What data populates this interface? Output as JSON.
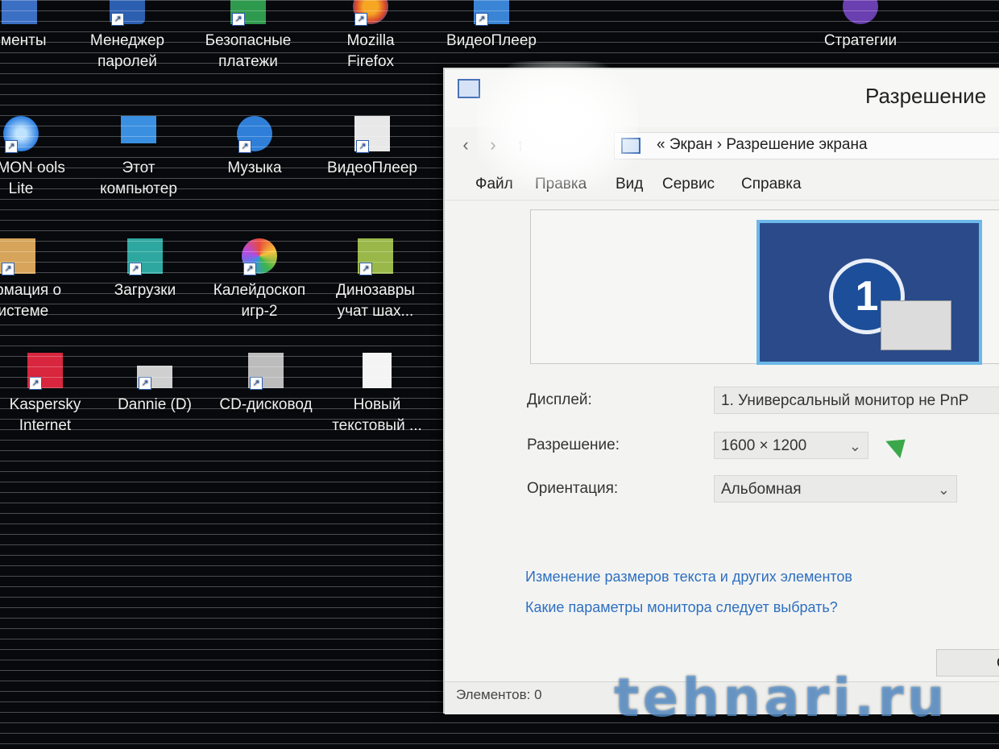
{
  "desktop": {
    "icons": [
      {
        "label": "ементы"
      },
      {
        "label": "Менеджер паролей"
      },
      {
        "label": "Безопасные платежи"
      },
      {
        "label": "Mozilla Firefox"
      },
      {
        "label": "ВидеоПлеер"
      },
      {
        "label": "Стратегии"
      },
      {
        "label": "AEMON ools Lite"
      },
      {
        "label": "Этот компьютер"
      },
      {
        "label": "Музыка"
      },
      {
        "label": "ВидеоПлеер"
      },
      {
        "label": "формация о Системе"
      },
      {
        "label": "Загрузки"
      },
      {
        "label": "Калейдоскоп игр-2"
      },
      {
        "label": "Динозавры учат шах..."
      },
      {
        "label": "Kaspersky Internet"
      },
      {
        "label": "Dannie (D)"
      },
      {
        "label": "CD-дисковод"
      },
      {
        "label": "Новый текстовый ..."
      }
    ]
  },
  "window": {
    "title": "Разрешение",
    "address": "« Экран › Разрешение экрана",
    "menu": [
      "Файл",
      "Правка",
      "Вид",
      "Сервис",
      "Справка"
    ],
    "monitor_number": "1",
    "fields": {
      "display_label": "Дисплей:",
      "display_value": "1. Универсальный монитор не PnP",
      "resolution_label": "Разрешение:",
      "resolution_value": "1600 × 1200",
      "orientation_label": "Ориентация:",
      "orientation_value": "Альбомная"
    },
    "links": {
      "text_size": "Изменение размеров текста и других элементов",
      "which_params": "Какие параметры монитора следует выбрать?"
    },
    "ok_label": "ОК",
    "status": "Элементов: 0"
  },
  "watermark": "tehnari.ru",
  "colors": {
    "desktop_bg": "#07090c",
    "window_bg": "#f3f4f2",
    "link": "#2f6fc0",
    "monitor_tile": "#2a4a8a",
    "watermark": "#5fa0e1"
  }
}
